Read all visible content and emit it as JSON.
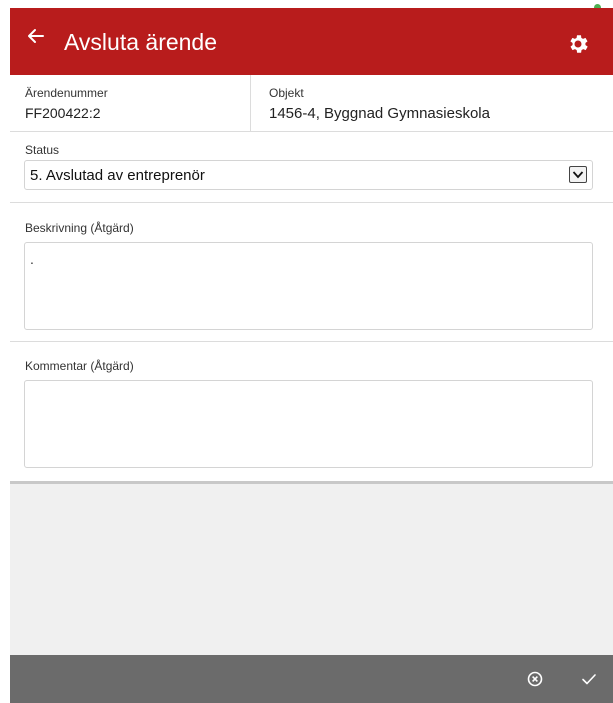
{
  "header": {
    "title": "Avsluta ärende",
    "back_icon": "arrow-left-icon",
    "settings_icon": "gear-icon",
    "bar_color": "#b81c1c",
    "indicator_color": "#4caf50"
  },
  "info": {
    "case_number_label": "Ärendenummer",
    "case_number_value": "FF200422:2",
    "object_label": "Objekt",
    "object_value": "1456-4, Byggnad Gymnasieskola"
  },
  "status": {
    "label": "Status",
    "selected": "5. Avslutad av entreprenör",
    "dropdown_icon": "chevron-down-icon"
  },
  "description": {
    "label": "Beskrivning (Åtgärd)",
    "value": "."
  },
  "comment": {
    "label": "Kommentar (Åtgärd)",
    "value": ""
  },
  "footer": {
    "cancel_icon": "circle-x-icon",
    "confirm_icon": "checkmark-icon",
    "bar_color": "#6b6b6b"
  }
}
